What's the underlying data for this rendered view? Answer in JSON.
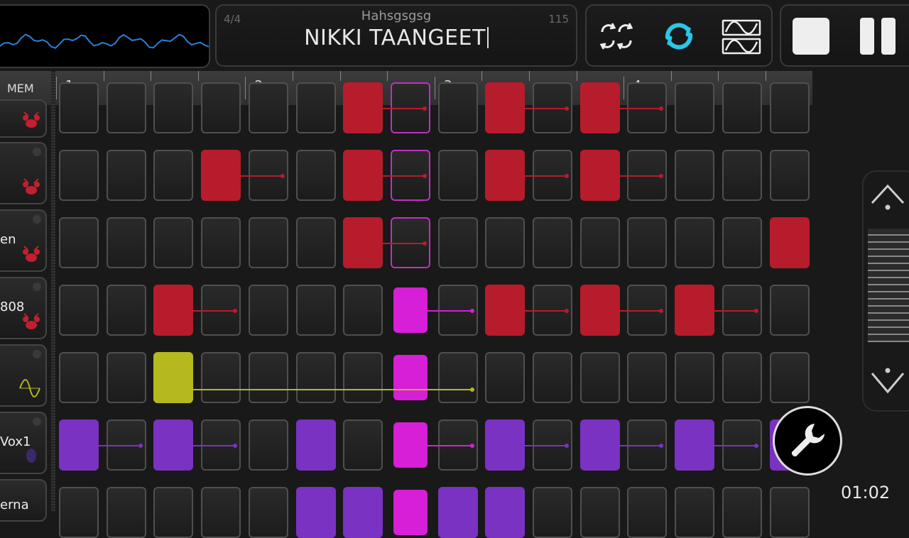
{
  "header": {
    "time_signature": "4/4",
    "bpm": "115",
    "song_subtitle": "Hahsgsgsg",
    "song_name": "NIKKI TAANGEET"
  },
  "mode_buttons": [
    "shuffle-icon",
    "loop-icon",
    "waveform-icon"
  ],
  "transport": [
    "stop-icon",
    "pause-icon"
  ],
  "ruler": {
    "mem_label": "MEM",
    "bars": [
      "1",
      "2",
      "3",
      "4"
    ]
  },
  "tracks": [
    {
      "name": "",
      "icon": "drum-kit-icon"
    },
    {
      "name": "",
      "icon": "drum-kit-icon"
    },
    {
      "name": "en",
      "icon": "drum-kit-icon"
    },
    {
      "name": "808",
      "icon": "drum-kit-icon"
    },
    {
      "name": "",
      "icon": "sine-wave-icon"
    },
    {
      "name": "Vox1",
      "icon": "mic-icon"
    },
    {
      "name": "erna",
      "icon": ""
    }
  ],
  "grid": {
    "columns": 16,
    "rows": [
      {
        "notes": [
          [
            6,
            2,
            "red"
          ],
          [
            9,
            2,
            "red"
          ],
          [
            11,
            2,
            "red"
          ]
        ],
        "outline": [
          7
        ]
      },
      {
        "notes": [
          [
            3,
            2,
            "red"
          ],
          [
            6,
            2,
            "red"
          ],
          [
            9,
            2,
            "red"
          ],
          [
            11,
            2,
            "red"
          ]
        ],
        "outline": [
          7
        ]
      },
      {
        "notes": [
          [
            6,
            2,
            "red"
          ],
          [
            15,
            1,
            "red"
          ]
        ],
        "outline": [
          7
        ]
      },
      {
        "notes": [
          [
            2,
            2,
            "red"
          ],
          [
            7,
            2,
            "magenta"
          ],
          [
            9,
            2,
            "red"
          ],
          [
            11,
            2,
            "red"
          ],
          [
            13,
            2,
            "red"
          ]
        ],
        "outline": []
      },
      {
        "notes": [
          [
            2,
            7,
            "yellow"
          ],
          [
            7,
            1,
            "magenta"
          ]
        ],
        "outline": []
      },
      {
        "notes": [
          [
            0,
            2,
            "purple"
          ],
          [
            2,
            2,
            "purple"
          ],
          [
            5,
            1,
            "purple"
          ],
          [
            7,
            2,
            "magenta"
          ],
          [
            9,
            2,
            "purple"
          ],
          [
            11,
            2,
            "purple"
          ],
          [
            13,
            2,
            "purple"
          ],
          [
            15,
            1,
            "purple"
          ]
        ],
        "outline": []
      },
      {
        "notes": [
          [
            5,
            1,
            "purple"
          ],
          [
            6,
            1,
            "purple"
          ],
          [
            7,
            1,
            "magenta"
          ],
          [
            8,
            1,
            "purple"
          ],
          [
            9,
            1,
            "purple"
          ]
        ],
        "outline": []
      }
    ]
  },
  "colors": {
    "red": "#b71c2c",
    "magenta": "#d61fd6",
    "yellow": "#b5b91e",
    "purple": "#7a32c2",
    "accent": "#2bc6e6"
  },
  "status": {
    "elapsed": "01:02"
  }
}
